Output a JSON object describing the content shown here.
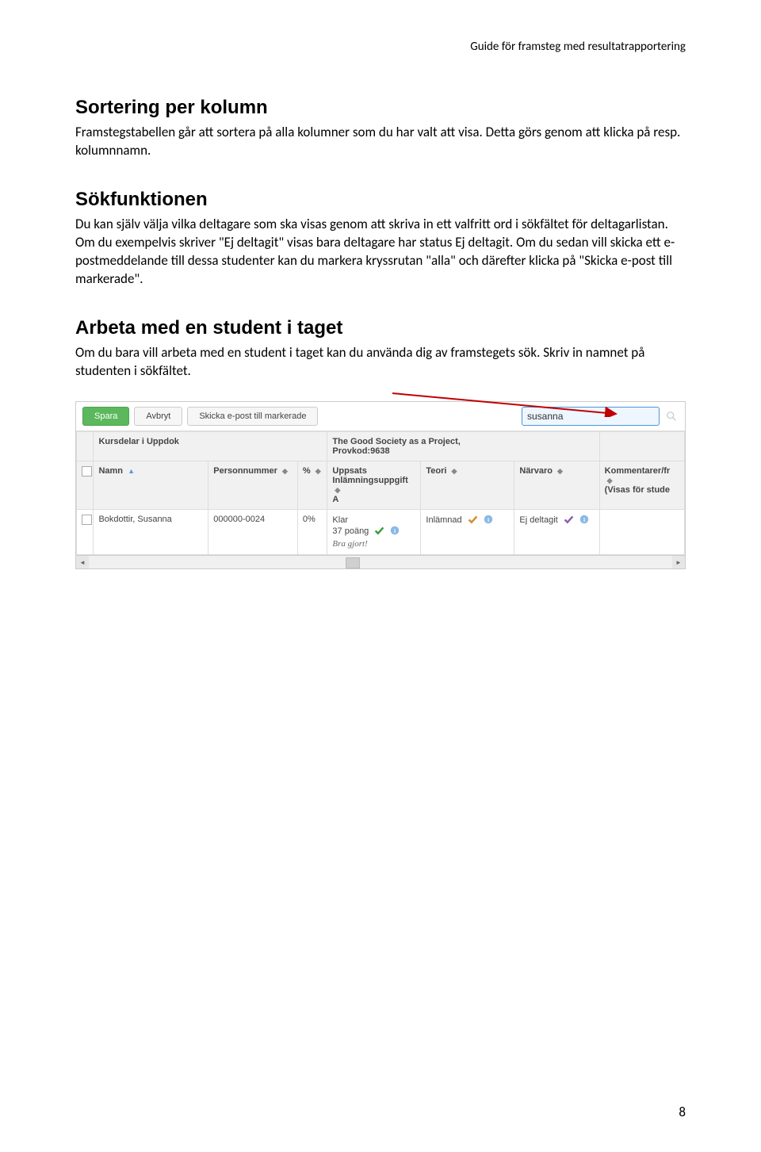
{
  "header": {
    "title": "Guide för framsteg med resultatrapportering"
  },
  "sections": {
    "sort": {
      "heading": "Sortering per kolumn",
      "body": "Framstegstabellen går att sortera på alla kolumner som du har valt att visa. Detta görs genom att klicka på resp. kolumnnamn."
    },
    "search": {
      "heading": "Sökfunktionen",
      "body": "Du kan själv välja vilka deltagare som ska visas genom att skriva in ett valfritt ord i sökfältet för deltagarlistan. Om du exempelvis skriver \"Ej deltagit\" visas bara deltagare har status Ej deltagit. Om du sedan vill skicka ett e-postmeddelande till dessa studenter kan du markera kryssrutan \"alla\" och därefter klicka på \"Skicka e-post till markerade\"."
    },
    "single": {
      "heading": "Arbeta med en student i taget",
      "body": "Om du bara vill arbeta med en student i taget kan du använda dig av framstegets sök. Skriv in namnet på studenten i sökfältet."
    }
  },
  "screenshot": {
    "toolbar": {
      "save": "Spara",
      "cancel": "Avbryt",
      "email": "Skicka e-post till markerade",
      "search_value": "susanna"
    },
    "grid": {
      "row1": {
        "kursdelar": "Kursdelar i Uppdok",
        "project_l1": "The Good Society as a Project,",
        "project_l2": "Provkod:9638"
      },
      "row2": {
        "namn": "Namn",
        "personnummer": "Personnummer",
        "pct": "%",
        "uppsats_l1": "Uppsats",
        "uppsats_l2": "Inlämningsuppgift",
        "uppsats_l3": "A",
        "teori": "Teori",
        "narvaro": "Närvaro",
        "komment_l1": "Kommentarer/fr",
        "komment_l2": "(Visas för stude"
      },
      "data": {
        "name": "Bokdottir, Susanna",
        "pn": "000000-0024",
        "pct": "0%",
        "status_l1": "Klar",
        "status_l2": "37 poäng",
        "status_note": "Bra gjort!",
        "teori": "Inlämnad",
        "narvaro": "Ej deltagit"
      }
    }
  },
  "page_number": "8"
}
